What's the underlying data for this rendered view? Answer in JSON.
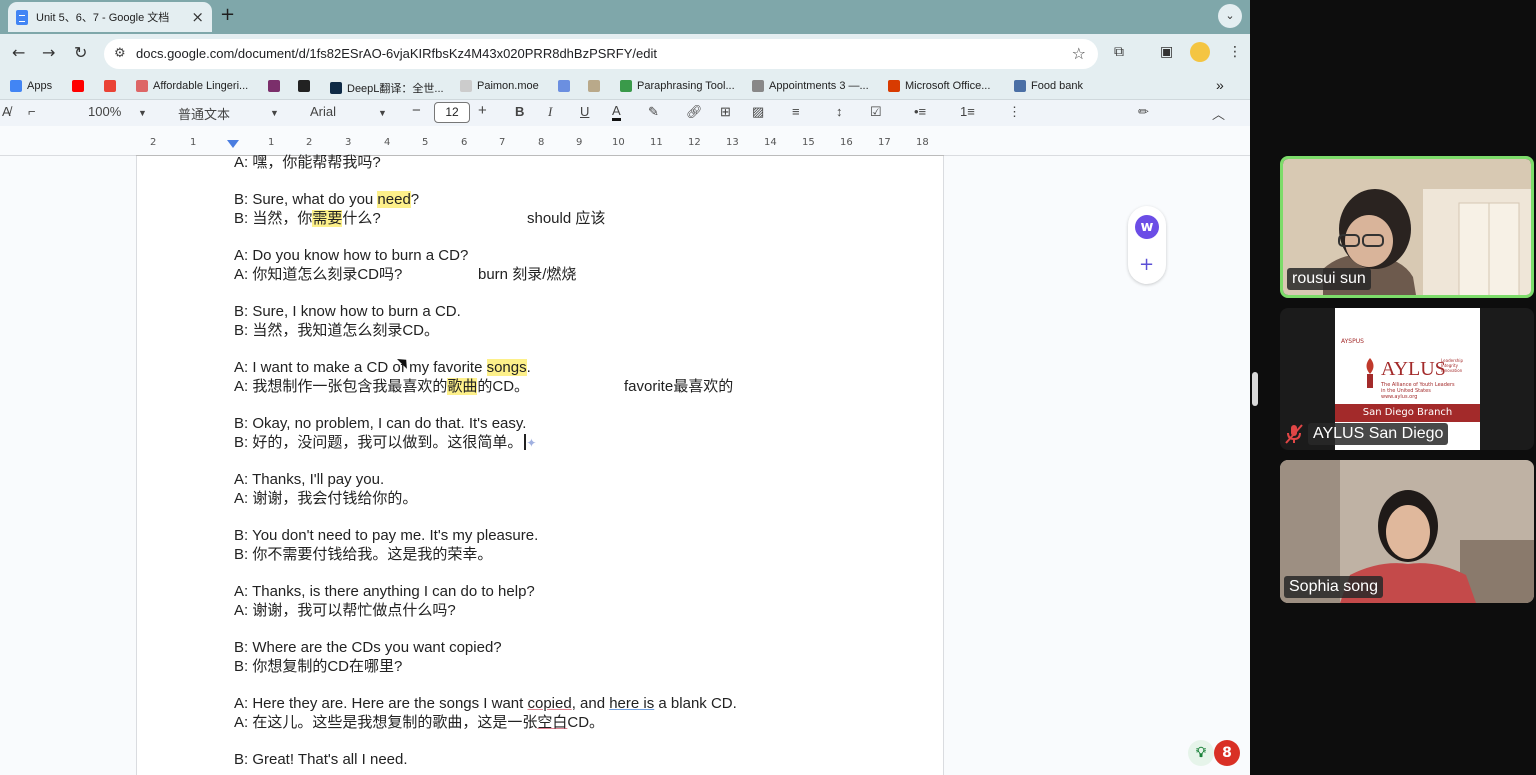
{
  "tab": {
    "title": "Unit 5、6、7 - Google 文档",
    "close": "×",
    "new": "+"
  },
  "omnibox": {
    "url": "docs.google.com/document/d/1fs82ESrAO-6vjaKIRfbsKz4M43x020PRR8dhBzPSRFY/edit"
  },
  "bookmarks": [
    "Apps",
    "Affordable Lingeri...",
    "DeepL翻译：全世...",
    "Paimon.moe",
    "Paraphrasing Tool...",
    "Appointments 3 —...",
    "Microsoft Office...",
    "Food bank"
  ],
  "doctoolbar": {
    "zoom": "100%",
    "style": "普通文本",
    "font": "Arial",
    "font_size": "12",
    "minus": "−",
    "plus": "+",
    "bold": "B",
    "italic": "I",
    "underline": "U",
    "textcolor": "A"
  },
  "ruler": [
    "2",
    "1",
    "1",
    "1",
    "2",
    "3",
    "4",
    "5",
    "6",
    "7",
    "8",
    "9",
    "10",
    "11",
    "12",
    "13",
    "14",
    "15",
    "16",
    "17",
    "18"
  ],
  "doc": {
    "l0": "A: 嘿，你能帮帮我吗?",
    "d1": {
      "b1": "B: Sure, what do you ",
      "b1h": "need",
      "b1e": "?",
      "b2": "B: 当然，你",
      "b2h": "需要",
      "b2e": "什么?",
      "note": "should 应该"
    },
    "d2": {
      "a1": "A: Do you know how to burn a CD?",
      "a2": "A: 你知道怎么刻录CD吗?",
      "note": "burn 刻录/燃烧"
    },
    "d3": {
      "b1": "B: Sure, I know how to burn a CD.",
      "b2": "B: 当然，我知道怎么刻录CD。"
    },
    "d4": {
      "a1": "A: I want to make a CD of my favorite ",
      "a1h": "songs",
      "a1e": ".",
      "a2": "A: 我想制作一张包含我最喜欢的",
      "a2h": "歌曲",
      "a2e": "的CD。",
      "note": "favorite最喜欢的"
    },
    "d5": {
      "b1": "B: Okay, no problem, I can do that. It's easy.",
      "b2": "B: 好的，没问题，我可以做到。这很简单。"
    },
    "d6": {
      "a1": "A: Thanks, I'll pay you.",
      "a2": "A: 谢谢，我会付钱给你的。"
    },
    "d7": {
      "b1": "B: You don't need to pay me. It's my pleasure.",
      "b2": "B: 你不需要付钱给我。这是我的荣幸。"
    },
    "d8": {
      "a1": "A: Thanks, is there anything I can do to help?",
      "a2": "A: 谢谢，我可以帮忙做点什么吗?"
    },
    "d9": {
      "b1": "B: Where are the CDs you want copied?",
      "b2": "B: 你想复制的CD在哪里?"
    },
    "d10": {
      "a1p": "A: Here they are. Here are the songs I want ",
      "a1u": "copied",
      "a1m": ", and ",
      "a1u2": "here is",
      "a1e": " a blank CD.",
      "a2p": "A: 在这儿。这些是我想复制的歌曲，这是一张",
      "a2u": "空白",
      "a2e": "CD。"
    },
    "d11": {
      "b1": "B: Great! That's all I need."
    }
  },
  "fab_badge": "8",
  "participants": [
    {
      "name": "rousui sun"
    },
    {
      "name": "AYLUS San Diego"
    },
    {
      "name": "Sophia song"
    }
  ],
  "aylus": {
    "top": "AYSPUS",
    "brand": "AYLUS",
    "tag1": "Leadership",
    "tag2": "Integrity",
    "tag3": "Innovation",
    "sub1": "The Alliance of Youth Leaders",
    "sub2": "in the United States",
    "site": "www.aylus.org",
    "branch": "San Diego Branch"
  },
  "colors": {
    "tabstrip": "#7fa7aa",
    "toolbar": "#e4eef1",
    "highlight": "#fdf08a",
    "active_border": "#7ddc6a",
    "aylus_red": "#a32a2a"
  }
}
